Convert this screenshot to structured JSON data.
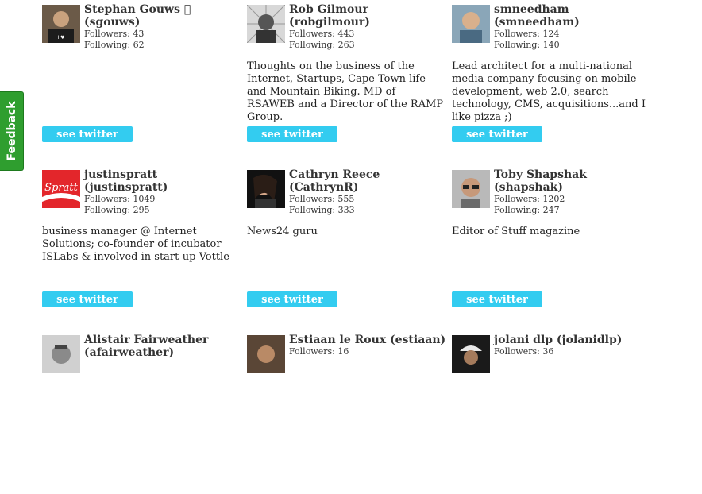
{
  "feedback_label": "Feedback",
  "button_label": "see twitter",
  "followers_label": "Followers:",
  "following_label": "Following:",
  "users": [
    {
      "name": "Stephan Gouws \u0000 (sgouws)",
      "followers": "43",
      "following": "62",
      "bio": ""
    },
    {
      "name": "Rob Gilmour (robgilmour)",
      "followers": "443",
      "following": "263",
      "bio": "Thoughts on the business of the Internet, Startups, Cape Town life and Mountain Biking. MD of RSAWEB and a Director of the RAMP Group."
    },
    {
      "name": "smneedham (smneedham)",
      "followers": "124",
      "following": "140",
      "bio": "Lead architect for a multi-national media company focusing on mobile development, web 2.0, search technology, CMS, acquisitions...and I like pizza ;)"
    },
    {
      "name": "justinspratt (justinspratt)",
      "followers": "1049",
      "following": "295",
      "bio": "business manager @ Internet Solutions; co-founder of incubator ISLabs & involved in start-up Vottle"
    },
    {
      "name": "Cathryn Reece (CathrynR)",
      "followers": "555",
      "following": "333",
      "bio": "News24 guru"
    },
    {
      "name": "Toby Shapshak (shapshak)",
      "followers": "1202",
      "following": "247",
      "bio": "Editor of Stuff magazine"
    },
    {
      "name": "Alistair Fairweather (afairweather)",
      "followers": "",
      "following": "",
      "bio": ""
    },
    {
      "name": "Estiaan le Roux (estiaan)",
      "followers": "16",
      "following": "",
      "bio": ""
    },
    {
      "name": "jolani dlp (jolanidlp)",
      "followers": "36",
      "following": "",
      "bio": ""
    }
  ]
}
